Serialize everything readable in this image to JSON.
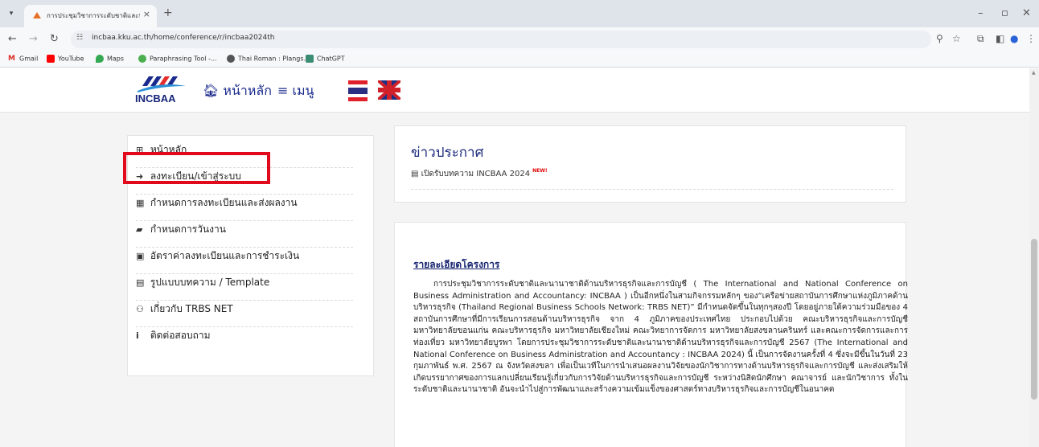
{
  "browser": {
    "tab_title": "การประชุมวิชาการระดับชาติและนานาช",
    "tab_close": "×",
    "new_tab": "+",
    "url": "incbaa.kku.ac.th/home/conference/r/incbaa2024th",
    "bookmarks": [
      "Gmail",
      "YouTube",
      "Maps",
      "Paraphrasing Tool -...",
      "Thai Roman : Plangs...",
      "ChatGPT"
    ],
    "icons": [
      "tab-menu-icon",
      "back-icon",
      "forward-icon",
      "reload-icon",
      "site-info-icon",
      "zoom-icon",
      "star-icon",
      "extensions-icon",
      "side-panel-icon",
      "profile-icon",
      "more-icon",
      "minimize-icon",
      "maximize-icon",
      "close-icon"
    ]
  },
  "header": {
    "logo_text": "INCBAA",
    "home_label": "หน้าหลัก",
    "menu_label": "เมนู"
  },
  "sidebar": {
    "items": [
      {
        "icon": "plus-square-icon",
        "label": "หน้าหลัก"
      },
      {
        "icon": "sign-in-icon",
        "label": "ลงทะเบียน/เข้าสู่ระบบ"
      },
      {
        "icon": "calendar-icon",
        "label": "กำหนดการลงทะเบียนและส่งผลงาน"
      },
      {
        "icon": "book-icon",
        "label": "กำหนดการวันงาน"
      },
      {
        "icon": "money-icon",
        "label": "อัตราค่าลงทะเบียนและการชำระเงิน"
      },
      {
        "icon": "file-icon",
        "label": "รูปแบบบทความ / Template"
      },
      {
        "icon": "users-icon",
        "label": "เกี่ยวกับ TRBS NET"
      },
      {
        "icon": "info-icon",
        "label": "ติดต่อสอบถาม"
      }
    ]
  },
  "news": {
    "title": "ข่าวประกาศ",
    "item": "เปิดรับบทความ INCBAA 2024",
    "badge": "NEW!"
  },
  "project": {
    "title": "รายละเอียดโครงการ",
    "body": "การประชุมวิชาการระดับชาติและนานาชาติด้านบริหารธุรกิจและการบัญชี ( The International and National Conference on Business Administration and Accountancy: INCBAA ) เป็นอีกหนึ่งในสามกิจกรรมหลักๆ ของ“เครือข่ายสถาบันการศึกษาแห่งภูมิภาคด้านบริหารธุรกิจ (Thailand Regional Business Schools Network: TRBS NET)” มีกำหนดจัดขึ้นในทุกๆสองปี โดยอยู่ภายใต้ความร่วมมือของ 4 สถาบันการศึกษาที่มีการเรียนการสอนด้านบริหารธุรกิจ จาก 4 ภูมิภาคของประเทศไทย ประกอบไปด้วย คณะบริหารธุรกิจและการบัญชี มหาวิทยาลัยขอนแก่น คณะบริหารธุรกิจ มหาวิทยาลัยเชียงใหม่ คณะวิทยาการจัดการ มหาวิทยาลัยสงขลานครินทร์ และคณะการจัดการและการท่องเที่ยว มหาวิทยาลัยบูรพา โดยการประชุมวิชาการระดับชาติและนานาชาติด้านบริหารธุรกิจและการบัญชี 2567 (The International and National Conference on Business Administration and Accountancy : INCBAA 2024) นี้ เป็นการจัดงานครั้งที่ 4 ซึ่งจะมีขึ้นในวันที่ 23 กุมภาพันธ์ พ.ศ. 2567 ณ จังหวัดสงขลา เพื่อเป็นเวทีในการนำเสนอผลงานวิจัยของนักวิชาการทางด้านบริหารธุรกิจและการบัญชี และส่งเสริมให้เกิดบรรยากาศของการแลกเปลี่ยนเรียนรู้เกี่ยวกับการวิจัยด้านบริหารธุรกิจและการบัญชี ระหว่างนิสิตนักศึกษา คณาจารย์ และนักวิชาการ ทั้งในระดับชาติและนานาชาติ อันจะนำไปสู่การพัฒนาและสร้างความเข้มแข็งของศาสตร์ทางบริหารธุรกิจและการบัญชีในอนาคต"
  },
  "colors": {
    "brand": "#1b2a7c",
    "highlight": "#e1091c"
  }
}
